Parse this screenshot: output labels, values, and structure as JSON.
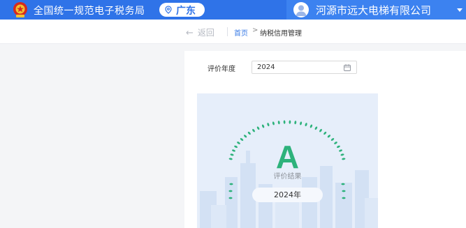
{
  "header": {
    "site_title": "全国统一规范电子税务局",
    "region": "广东",
    "company": "河源市远大电梯有限公司",
    "colors": {
      "bar": "#2f73e8",
      "user_box": "#3c82f0"
    }
  },
  "breadcrumb": {
    "back_label": "返回",
    "home": "首页",
    "separator": ">",
    "current": "纳税信用管理"
  },
  "filter": {
    "year_label": "评价年度",
    "year_value": "2024"
  },
  "result": {
    "grade": "A",
    "label": "评价结果",
    "year_text": "2024年",
    "colors": {
      "grade": "#2db27b",
      "card_bg": "#e6eefa"
    }
  },
  "icons": [
    "emblem-icon",
    "location-pin-icon",
    "user-avatar-icon",
    "chevron-down-icon",
    "back-arrow-icon",
    "calendar-icon"
  ]
}
